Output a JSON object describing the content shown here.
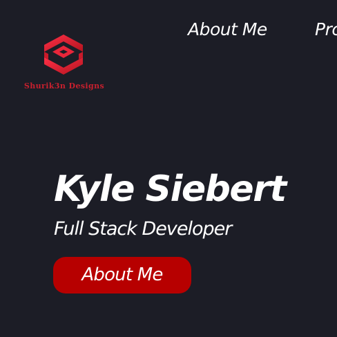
{
  "brand": {
    "name": "Shurik3n Designs",
    "logo_icon": "hexagon-cube-logo-icon",
    "accent_color": "#e8263a"
  },
  "nav": {
    "items": [
      {
        "label": "About Me"
      },
      {
        "label": "Pro"
      }
    ]
  },
  "hero": {
    "name": "Kyle Siebert",
    "role": "Full Stack Developer",
    "cta_label": "About Me",
    "cta_color": "#b70000"
  },
  "colors": {
    "background": "#1c1d26",
    "text": "#ffffff"
  }
}
